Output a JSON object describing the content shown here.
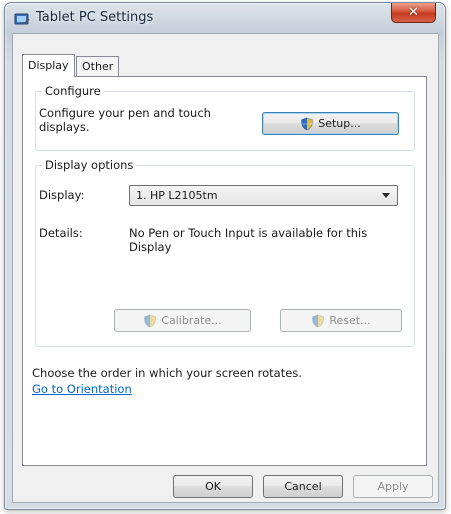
{
  "window": {
    "title": "Tablet PC Settings",
    "close_glyph": "✕"
  },
  "tabs": [
    {
      "label": "Display",
      "active": true
    },
    {
      "label": "Other",
      "active": false
    }
  ],
  "configure": {
    "group_label": "Configure",
    "description": "Configure your pen and touch displays.",
    "setup_button": "Setup..."
  },
  "display_options": {
    "group_label": "Display options",
    "display_label": "Display:",
    "display_value": "1. HP L2105tm",
    "details_label": "Details:",
    "details_value": "No Pen or Touch Input is available for this Display",
    "calibrate_button": "Calibrate...",
    "reset_button": "Reset..."
  },
  "orientation": {
    "text": "Choose the order in which your screen rotates.",
    "link": "Go to Orientation"
  },
  "footer": {
    "ok": "OK",
    "cancel": "Cancel",
    "apply": "Apply"
  },
  "colors": {
    "link": "#0066cc",
    "close_button": "#c63a1f",
    "shield_blue": "#2f6fc0",
    "shield_yellow": "#f2c230"
  },
  "icons": {
    "app": "tablet-pc-icon",
    "shield": "uac-shield-icon"
  }
}
